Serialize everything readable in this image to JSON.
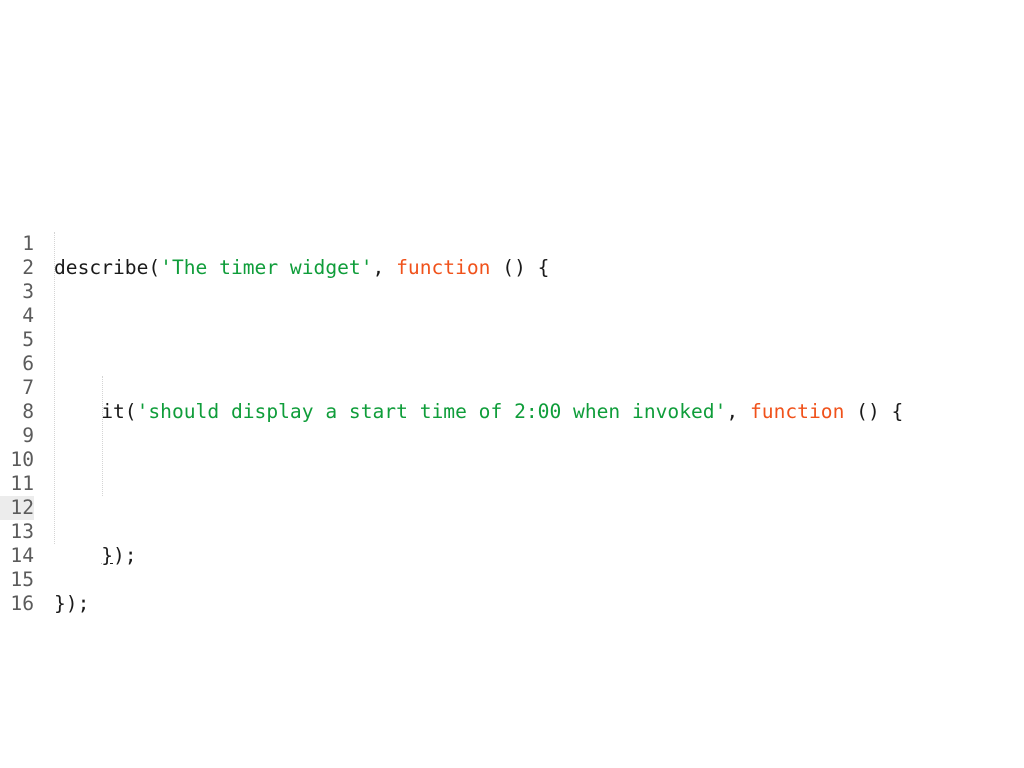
{
  "editor": {
    "line_numbers": [
      "1",
      "2",
      "3",
      "4",
      "5",
      "6",
      "7",
      "8",
      "9",
      "10",
      "11",
      "12",
      "13",
      "14",
      "15",
      "16"
    ],
    "current_line": "12",
    "lines": {
      "l1": {
        "a": "describe(",
        "b": "'The timer widget'",
        "c": ", ",
        "d": "function",
        "e": " () {"
      },
      "l7": {
        "indent": "    ",
        "a": "it(",
        "b": "'should display a start time of 2:00 when invoked'",
        "c": ", ",
        "d": "function",
        "e": " () {"
      },
      "l13": {
        "indent": "    ",
        "a": "}",
        "b": ");"
      },
      "l15": {
        "a": "});"
      }
    },
    "colors": {
      "string": "#0f9d3a",
      "keyword": "#f0521b",
      "text": "#1a1a1a",
      "line_number": "#5b5b5b",
      "current_line_bg": "#ececec"
    }
  }
}
